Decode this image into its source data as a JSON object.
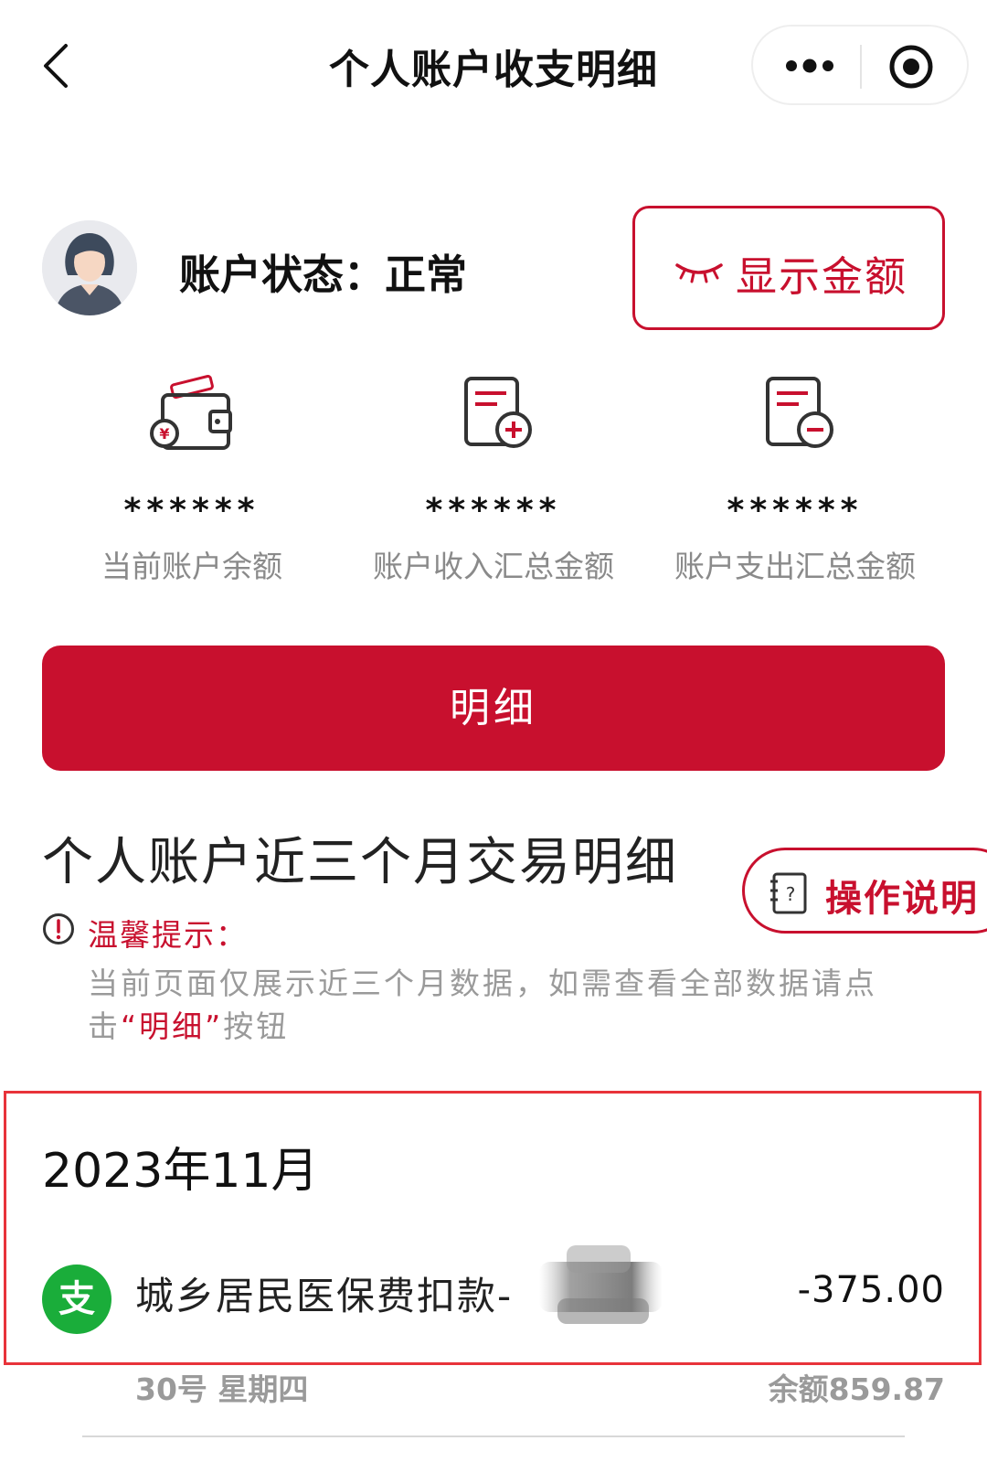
{
  "nav": {
    "title": "个人账户收支明细"
  },
  "account": {
    "status_label": "账户状态：正常",
    "show_amount_label": "显示金额"
  },
  "stats": [
    {
      "value": "******",
      "label": "当前账户余额",
      "icon": "wallet-icon"
    },
    {
      "value": "******",
      "label": "账户收入汇总金额",
      "icon": "document-plus-icon"
    },
    {
      "value": "******",
      "label": "账户支出汇总金额",
      "icon": "document-minus-icon"
    }
  ],
  "detail_button": "明细",
  "section": {
    "title": "个人账户近三个月交易明细",
    "help_label": "操作说明",
    "tip_title": "温馨提示：",
    "tip_body_before": "当前页面仅展示近三个月数据，如需查看全部数据请点击",
    "tip_body_highlight": "“明细”",
    "tip_body_after": "按钮"
  },
  "transactions": {
    "month": "2023年11月",
    "items": [
      {
        "icon_char": "支",
        "name": "城乡居民医保费扣款-",
        "amount": "-375.00",
        "date": "30号 星期四",
        "balance": "余额859.87"
      }
    ]
  },
  "colors": {
    "accent": "#c8102e",
    "highlight_box": "#e8333a",
    "wechat_green": "#1aad3a"
  }
}
